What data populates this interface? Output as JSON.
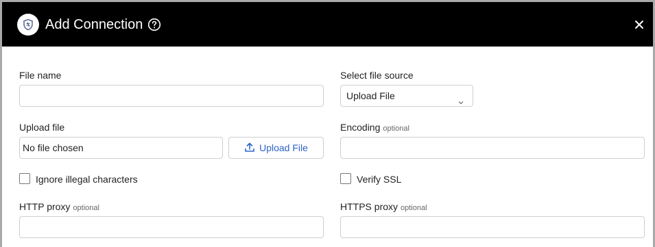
{
  "dialog": {
    "title": "Add Connection",
    "icons": {
      "logo": "shield-logo-icon",
      "help": "help-circle-icon",
      "close": "close-icon"
    }
  },
  "form": {
    "file_name": {
      "label": "File name",
      "value": ""
    },
    "file_source": {
      "label": "Select file source",
      "selected": "Upload File"
    },
    "upload_file": {
      "label": "Upload file",
      "file_status": "No file chosen",
      "button_label": "Upload File"
    },
    "encoding": {
      "label": "Encoding",
      "optional": "optional",
      "value": ""
    },
    "ignore_illegal": {
      "label": "Ignore illegal characters",
      "checked": false
    },
    "verify_ssl": {
      "label": "Verify SSL",
      "checked": false
    },
    "http_proxy": {
      "label": "HTTP proxy",
      "optional": "optional",
      "value": ""
    },
    "https_proxy": {
      "label": "HTTPS proxy",
      "optional": "optional",
      "value": ""
    }
  },
  "colors": {
    "header_bg": "#000000",
    "accent": "#2d63c8",
    "border": "#cfcfcf"
  }
}
